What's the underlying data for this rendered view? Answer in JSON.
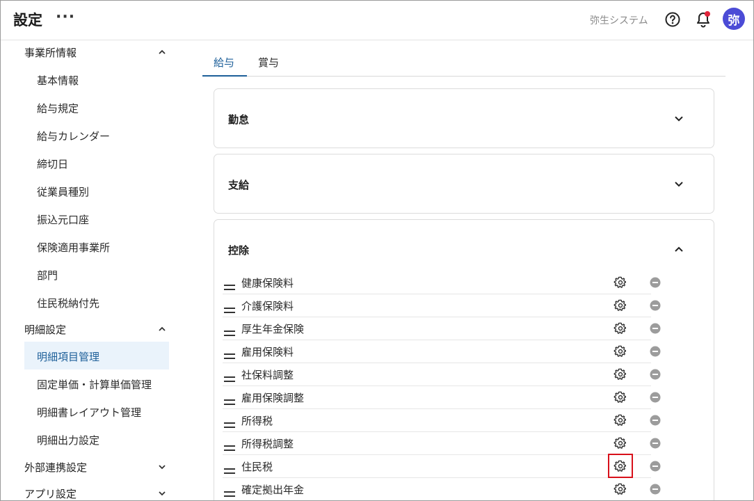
{
  "header": {
    "title": "設定",
    "more": "···",
    "org": "弥生システム",
    "avatar": "弥",
    "icons": {
      "help": "help-circle-icon",
      "bell": "bell-icon",
      "notify_color": "#e0243a"
    }
  },
  "sidebar": {
    "sections": [
      {
        "label": "事業所情報",
        "expanded": true,
        "items": [
          "基本情報",
          "給与規定",
          "給与カレンダー",
          "締切日",
          "従業員種別",
          "振込元口座",
          "保険適用事業所",
          "部門",
          "住民税納付先"
        ]
      },
      {
        "label": "明細設定",
        "expanded": true,
        "items": [
          "明細項目管理",
          "固定単価・計算単価管理",
          "明細書レイアウト管理",
          "明細出力設定"
        ],
        "active": "明細項目管理"
      },
      {
        "label": "外部連携設定",
        "expanded": false,
        "items": []
      },
      {
        "label": "アプリ設定",
        "expanded": false,
        "items": []
      }
    ]
  },
  "tabs": [
    {
      "label": "給与",
      "active": true
    },
    {
      "label": "賞与",
      "active": false
    }
  ],
  "cards": [
    {
      "title": "勤怠",
      "expanded": false
    },
    {
      "title": "支給",
      "expanded": false
    },
    {
      "title": "控除",
      "expanded": true,
      "rows": [
        "健康保険料",
        "介護保険料",
        "厚生年金保険",
        "雇用保険料",
        "社保料調整",
        "雇用保険調整",
        "所得税",
        "所得税調整",
        "住民税",
        "確定拠出年金"
      ],
      "highlighted_row": "住民税"
    }
  ],
  "colors": {
    "accent": "#1d5f99",
    "avatar_bg": "#4b4bd6",
    "highlight": "#d8101a",
    "active_bg": "#eaf3fb"
  }
}
